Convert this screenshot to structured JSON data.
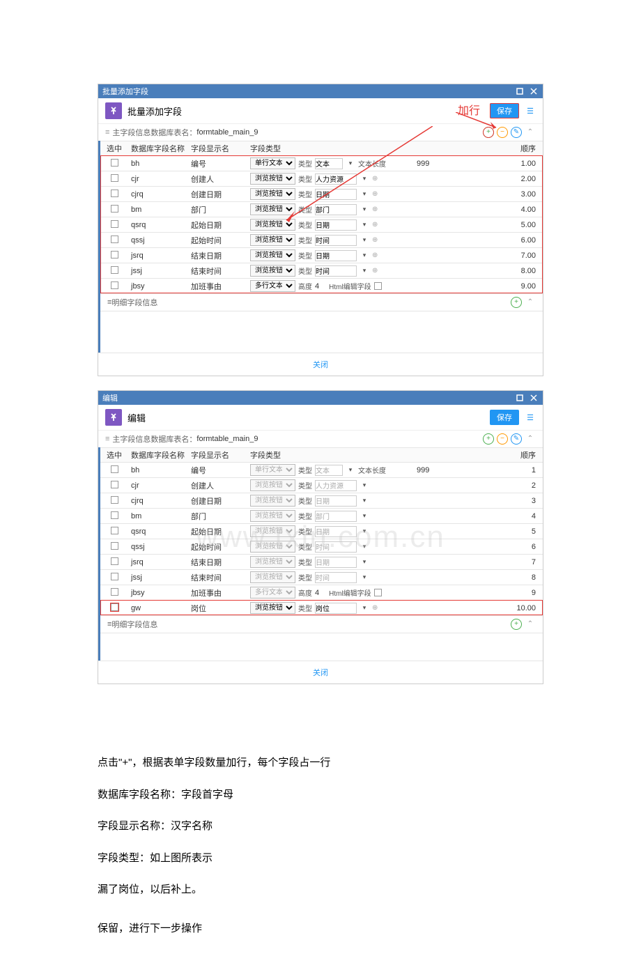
{
  "dialog1": {
    "titlebar": "批量添加字段",
    "header_title": "批量添加字段",
    "save_label": "保存",
    "subheader_prefix": "主字段信息数据库表名：",
    "table_name": "formtable_main_9",
    "annotation_add_row": "加行",
    "cols": {
      "sel": "选中",
      "db": "数据库字段名称",
      "disp": "字段显示名",
      "type": "字段类型",
      "order": "顺序"
    },
    "rows": [
      {
        "db": "bh",
        "disp": "编号",
        "type_sel": "单行文本框",
        "kind_label": "类型",
        "kind_val": "文本",
        "extra_label": "文本长度",
        "extra_val": "999",
        "order": "1.00"
      },
      {
        "db": "cjr",
        "disp": "创建人",
        "type_sel": "浏览按钮",
        "kind_label": "类型",
        "kind_val": "人力资源",
        "has_star": true,
        "order": "2.00"
      },
      {
        "db": "cjrq",
        "disp": "创建日期",
        "type_sel": "浏览按钮",
        "kind_label": "类型",
        "kind_val": "日期",
        "has_star": true,
        "order": "3.00"
      },
      {
        "db": "bm",
        "disp": "部门",
        "type_sel": "浏览按钮",
        "kind_label": "类型",
        "kind_val": "部门",
        "has_star": true,
        "order": "4.00"
      },
      {
        "db": "qsrq",
        "disp": "起始日期",
        "type_sel": "浏览按钮",
        "kind_label": "类型",
        "kind_val": "日期",
        "has_star": true,
        "order": "5.00"
      },
      {
        "db": "qssj",
        "disp": "起始时间",
        "type_sel": "浏览按钮",
        "kind_label": "类型",
        "kind_val": "时间",
        "has_star": true,
        "order": "6.00"
      },
      {
        "db": "jsrq",
        "disp": "结束日期",
        "type_sel": "浏览按钮",
        "kind_label": "类型",
        "kind_val": "日期",
        "has_star": true,
        "order": "7.00"
      },
      {
        "db": "jssj",
        "disp": "结束时间",
        "type_sel": "浏览按钮",
        "kind_label": "类型",
        "kind_val": "时间",
        "has_star": true,
        "order": "8.00"
      },
      {
        "db": "jbsy",
        "disp": "加班事由",
        "type_sel": "多行文本框",
        "kind_label": "高度",
        "kind_val": "4",
        "html_label": "Html编辑字段",
        "order": "9.00"
      }
    ],
    "detail_title": "明细字段信息",
    "close_link": "关闭"
  },
  "dialog2": {
    "titlebar": "编辑",
    "header_title": "编辑",
    "save_label": "保存",
    "subheader_prefix": "主字段信息数据库表名：",
    "table_name": "formtable_main_9",
    "cols": {
      "sel": "选中",
      "db": "数据库字段名称",
      "disp": "字段显示名",
      "type": "字段类型",
      "order": "顺序"
    },
    "rows": [
      {
        "db": "bh",
        "disp": "编号",
        "type_sel": "单行文本框",
        "kind_label": "类型",
        "kind_val": "文本",
        "extra_label": "文本长度",
        "extra_val": "999",
        "order": "1"
      },
      {
        "db": "cjr",
        "disp": "创建人",
        "type_sel": "浏览按钮",
        "kind_label": "类型",
        "kind_val": "人力资源",
        "order": "2"
      },
      {
        "db": "cjrq",
        "disp": "创建日期",
        "type_sel": "浏览按钮",
        "kind_label": "类型",
        "kind_val": "日期",
        "order": "3"
      },
      {
        "db": "bm",
        "disp": "部门",
        "type_sel": "浏览按钮",
        "kind_label": "类型",
        "kind_val": "部门",
        "order": "4"
      },
      {
        "db": "qsrq",
        "disp": "起始日期",
        "type_sel": "浏览按钮",
        "kind_label": "类型",
        "kind_val": "日期",
        "order": "5"
      },
      {
        "db": "qssj",
        "disp": "起始时间",
        "type_sel": "浏览按钮",
        "kind_label": "类型",
        "kind_val": "时间",
        "order": "6"
      },
      {
        "db": "jsrq",
        "disp": "结束日期",
        "type_sel": "浏览按钮",
        "kind_label": "类型",
        "kind_val": "日期",
        "order": "7"
      },
      {
        "db": "jssj",
        "disp": "结束时间",
        "type_sel": "浏览按钮",
        "kind_label": "类型",
        "kind_val": "时间",
        "order": "8"
      },
      {
        "db": "jbsy",
        "disp": "加班事由",
        "type_sel": "多行文本框",
        "kind_label": "高度",
        "kind_val": "4",
        "html_label": "Html编辑字段",
        "order": "9"
      },
      {
        "db": "gw",
        "disp": "岗位",
        "type_sel": "浏览按钮",
        "kind_label": "类型",
        "kind_val": "岗位",
        "has_star": true,
        "order": "10.00",
        "highlighted": true
      }
    ],
    "detail_title": "明细字段信息",
    "close_link": "关闭",
    "watermark": "www.txin.com.cn"
  },
  "notes": [
    "点击\"+\"，根据表单字段数量加行，每个字段占一行",
    "数据库字段名称：字段首字母",
    "字段显示名称：汉字名称",
    "字段类型：如上图所表示",
    "漏了岗位，以后补上。",
    "保留，进行下一步操作"
  ]
}
